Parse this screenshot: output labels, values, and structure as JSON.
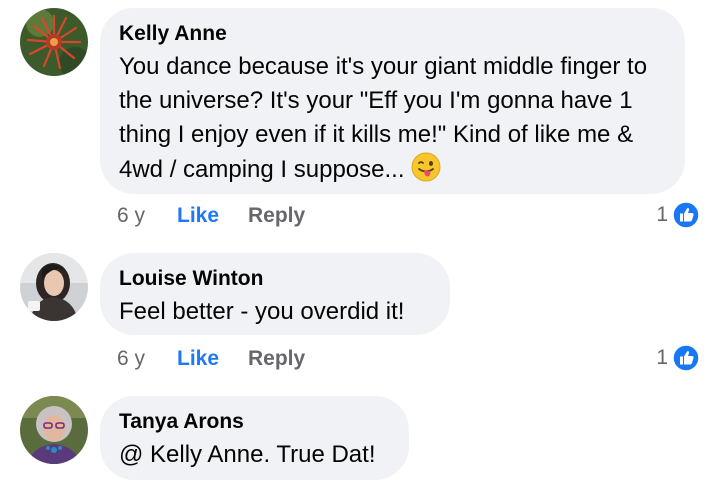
{
  "comments": [
    {
      "author": "Kelly Anne",
      "text": "You dance because it's your giant middle finger to the universe? It's your \"Eff you I'm gonna have 1 thing I enjoy even if it kills me!\" Kind of like me & 4wd / camping I suppose...",
      "emoji": "winking-tongue-emoji",
      "time": "6 y",
      "like_label": "Like",
      "reply_label": "Reply",
      "reaction_count": "1",
      "reaction_icon": "thumbs-up-icon"
    },
    {
      "author": "Louise Winton",
      "text": "Feel better - you overdid it!",
      "time": "6 y",
      "like_label": "Like",
      "reply_label": "Reply",
      "reaction_count": "1",
      "reaction_icon": "thumbs-up-icon"
    },
    {
      "author": "Tanya Arons",
      "text": "@ Kelly Anne. True Dat!"
    }
  ],
  "colors": {
    "bubble": "#f0f2f5",
    "like_blue": "#2078f4",
    "secondary_text": "#65676b"
  }
}
